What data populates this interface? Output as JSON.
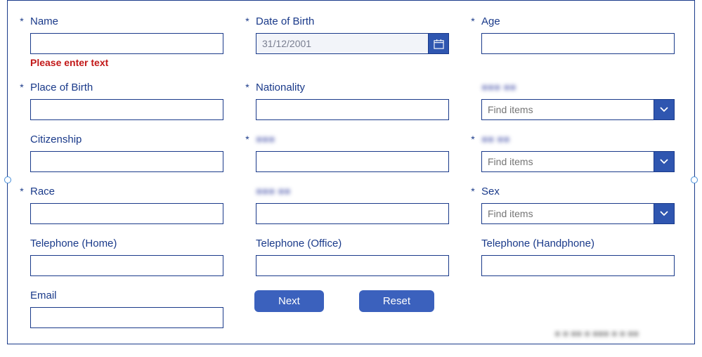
{
  "fields": {
    "name": {
      "label": "Name",
      "required": true,
      "value": "",
      "error": "Please enter text"
    },
    "dob": {
      "label": "Date of Birth",
      "required": true,
      "value": "31/12/2001"
    },
    "age": {
      "label": "Age",
      "required": true,
      "value": ""
    },
    "pob": {
      "label": "Place of Birth",
      "required": true,
      "value": ""
    },
    "nationality": {
      "label": "Nationality",
      "required": true,
      "value": ""
    },
    "obscured1": {
      "label": "■■■ ■■",
      "required": false,
      "placeholder": "Find items"
    },
    "citizenship": {
      "label": "Citizenship",
      "required": false,
      "value": ""
    },
    "obscured2": {
      "label": "■■■",
      "required": true,
      "value": ""
    },
    "obscured3": {
      "label": "■■ ■■",
      "required": true,
      "placeholder": "Find items"
    },
    "race": {
      "label": "Race",
      "required": true,
      "value": ""
    },
    "obscured4": {
      "label": "■■■ ■■",
      "required": false,
      "value": ""
    },
    "sex": {
      "label": "Sex",
      "required": true,
      "placeholder": "Find items"
    },
    "telHome": {
      "label": "Telephone (Home)",
      "required": false,
      "value": ""
    },
    "telOffice": {
      "label": "Telephone (Office)",
      "required": false,
      "value": ""
    },
    "telHp": {
      "label": "Telephone (Handphone)",
      "required": false,
      "value": ""
    },
    "email": {
      "label": "Email",
      "required": false,
      "value": ""
    }
  },
  "buttons": {
    "next": "Next",
    "reset": "Reset"
  },
  "footerBlur": "■ ■ ■■ ■ ■■■ ■ ■ ■■"
}
